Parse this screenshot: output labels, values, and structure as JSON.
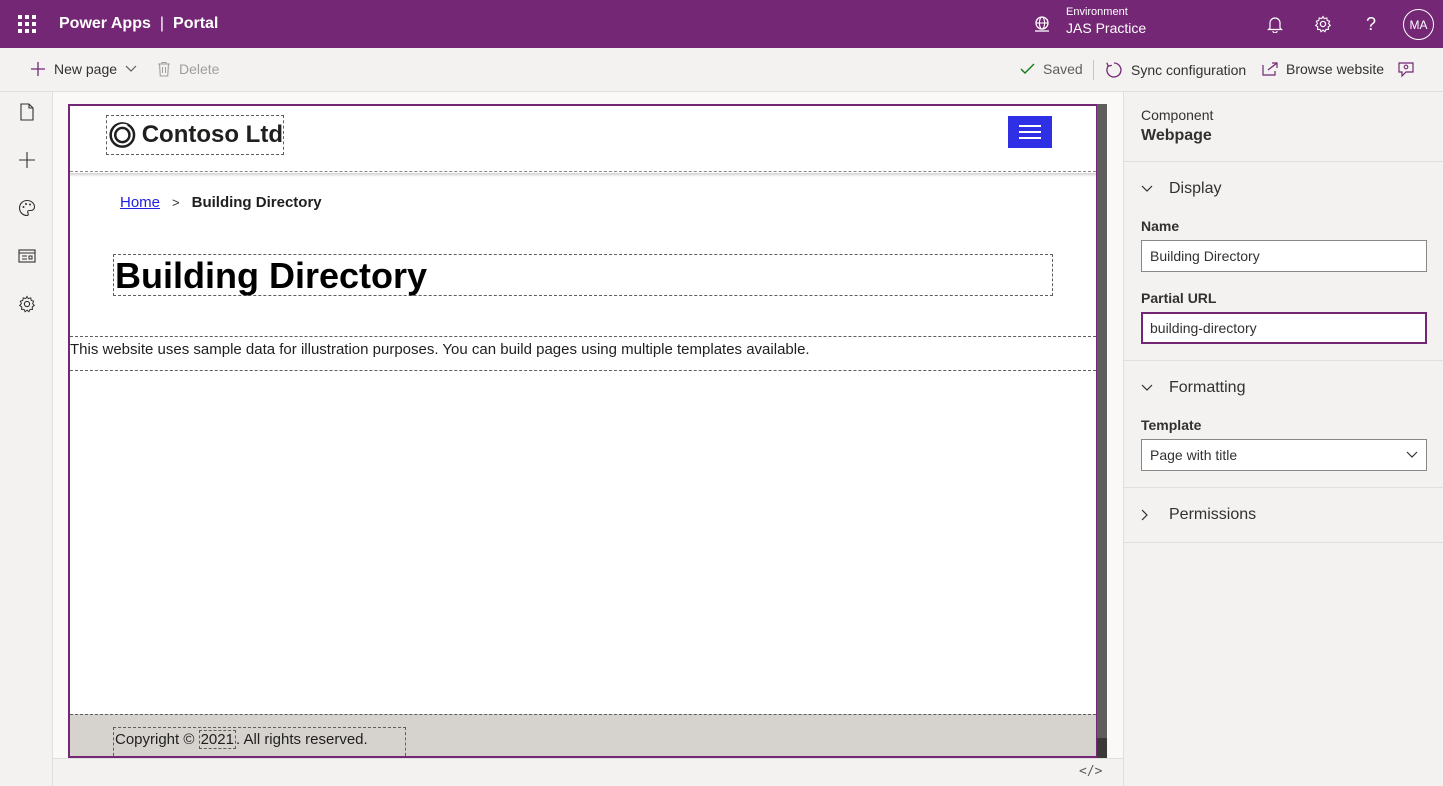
{
  "topbar": {
    "app_name": "Power Apps",
    "separator": "|",
    "app_section": "Portal",
    "environment_label": "Environment",
    "environment_name": "JAS Practice",
    "user_initials": "MA"
  },
  "command_bar": {
    "new_page_label": "New page",
    "delete_label": "Delete",
    "saved_label": "Saved",
    "sync_label": "Sync configuration",
    "browse_label": "Browse website"
  },
  "site": {
    "logo_text": "Contoso Ltd",
    "breadcrumb": {
      "home": "Home",
      "separator": ">",
      "current": "Building Directory"
    },
    "page_title": "Building Directory",
    "content_text": "This website uses sample data for illustration purposes. You can build pages using multiple templates available.",
    "footer": {
      "prefix": "Copyright © ",
      "year": "2021",
      "suffix": ". All rights reserved."
    }
  },
  "code_toggle": "</>",
  "panel": {
    "component_label": "Component",
    "component_value": "Webpage",
    "display_section": "Display",
    "name_label": "Name",
    "name_value": "Building Directory",
    "partial_url_label": "Partial URL",
    "partial_url_value": "building-directory",
    "formatting_section": "Formatting",
    "template_label": "Template",
    "template_value": "Page with title",
    "permissions_section": "Permissions"
  },
  "colors": {
    "brand": "#742774",
    "hamburger": "#2f2fe6",
    "footer_bg": "#d6d3cf",
    "saved_check": "#107c10"
  }
}
